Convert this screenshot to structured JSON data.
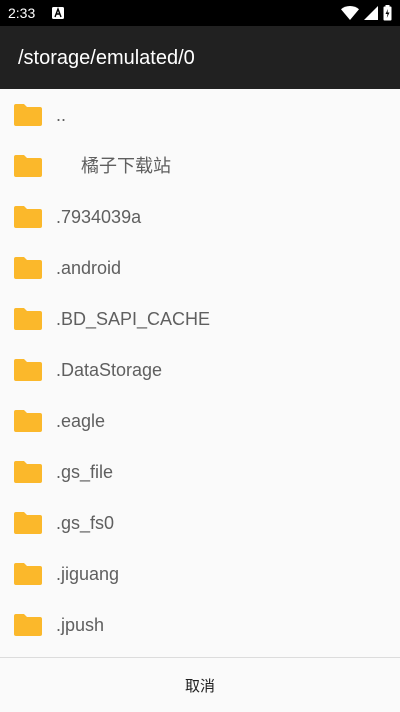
{
  "status_bar": {
    "time": "2:33",
    "icons": [
      "notification-a-icon",
      "wifi-icon",
      "signal-icon",
      "battery-icon"
    ]
  },
  "header": {
    "title": "/storage/emulated/0"
  },
  "files": [
    {
      "name": "..",
      "icon": "folder-icon"
    },
    {
      "name": "     橘子下载站",
      "icon": "folder-icon"
    },
    {
      "name": ".7934039a",
      "icon": "folder-icon"
    },
    {
      "name": ".android",
      "icon": "folder-icon"
    },
    {
      "name": ".BD_SAPI_CACHE",
      "icon": "folder-icon"
    },
    {
      "name": ".DataStorage",
      "icon": "folder-icon"
    },
    {
      "name": ".eagle",
      "icon": "folder-icon"
    },
    {
      "name": ".gs_file",
      "icon": "folder-icon"
    },
    {
      "name": ".gs_fs0",
      "icon": "folder-icon"
    },
    {
      "name": ".jiguang",
      "icon": "folder-icon"
    },
    {
      "name": ".jpush",
      "icon": "folder-icon"
    }
  ],
  "footer": {
    "cancel_label": "取消"
  },
  "colors": {
    "folder": "#fbb82b",
    "app_bar": "#212121",
    "status_bar": "#000000",
    "list_background": "#fafafa",
    "file_text": "#5f5f5f"
  }
}
